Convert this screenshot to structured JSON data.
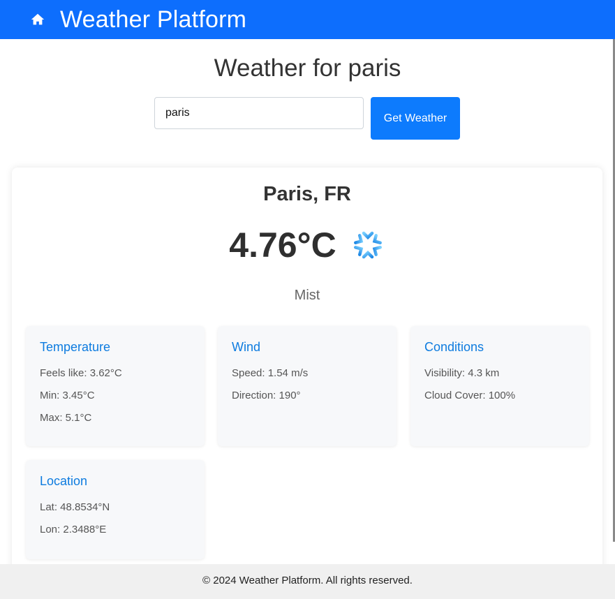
{
  "header": {
    "brand": "Weather Platform",
    "home_icon": "home-icon"
  },
  "page_title": "Weather for paris",
  "search": {
    "value": "paris",
    "button_label": "Get Weather"
  },
  "current": {
    "location": "Paris, FR",
    "temperature": "4.76°C",
    "condition_icon": "snowflake-icon",
    "condition": "Mist"
  },
  "details": {
    "temperature": {
      "title": "Temperature",
      "lines": [
        "Feels like: 3.62°C",
        "Min: 3.45°C",
        "Max: 5.1°C"
      ]
    },
    "wind": {
      "title": "Wind",
      "lines": [
        "Speed: 1.54 m/s",
        "Direction: 190°"
      ]
    },
    "conditions": {
      "title": "Conditions",
      "lines": [
        "Visibility: 4.3 km",
        "Cloud Cover: 100%"
      ]
    },
    "location": {
      "title": "Location",
      "lines": [
        "Lat: 48.8534°N",
        "Lon: 2.3488°E"
      ]
    }
  },
  "footer": {
    "text": "© 2024 Weather Platform. All rights reserved."
  },
  "colors": {
    "primary": "#0d6efd",
    "accent": "#0d7bdf"
  }
}
